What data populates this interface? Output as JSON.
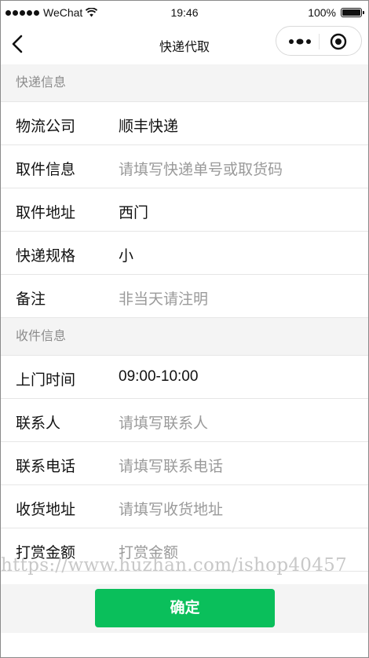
{
  "status_bar": {
    "carrier": "WeChat",
    "time": "19:46",
    "battery": "100%",
    "battery_level": 1.0
  },
  "nav": {
    "title": "快递代取",
    "back_icon": "chevron-left-icon",
    "more_icon": "more-dots-icon",
    "close_icon": "target-circle-icon"
  },
  "sections": [
    {
      "title": "快递信息",
      "rows": [
        {
          "label": "物流公司",
          "value": "顺丰快递",
          "placeholder": false
        },
        {
          "label": "取件信息",
          "value": "请填写快递单号或取货码",
          "placeholder": true
        },
        {
          "label": "取件地址",
          "value": "西门",
          "placeholder": false
        },
        {
          "label": "快递规格",
          "value": "小",
          "placeholder": false
        },
        {
          "label": "备注",
          "value": "非当天请注明",
          "placeholder": true
        }
      ]
    },
    {
      "title": "收件信息",
      "rows": [
        {
          "label": "上门时间",
          "value": "09:00-10:00",
          "placeholder": false
        },
        {
          "label": "联系人",
          "value": "请填写联系人",
          "placeholder": true
        },
        {
          "label": "联系电话",
          "value": "请填写联系电话",
          "placeholder": true
        },
        {
          "label": "收货地址",
          "value": "请填写收货地址",
          "placeholder": true
        },
        {
          "label": "打赏金额",
          "value": "打赏金额",
          "placeholder": true
        }
      ]
    }
  ],
  "watermark": "https://www.huzhan.com/ishop40457",
  "footer": {
    "confirm_label": "确定"
  },
  "colors": {
    "accent": "#0abf5b",
    "section_bg": "#f4f4f4",
    "placeholder": "#9a9a9a"
  }
}
